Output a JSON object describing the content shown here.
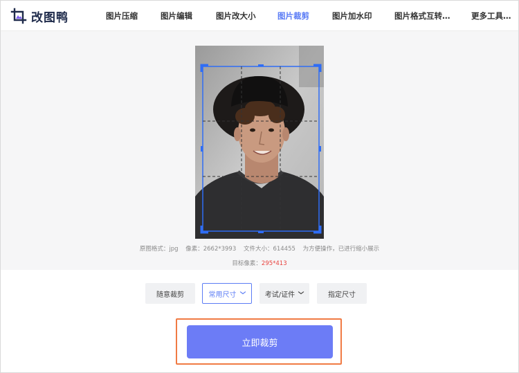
{
  "brand": {
    "name": "改图鸭",
    "icon": "crop-logo-icon"
  },
  "nav": {
    "items": [
      {
        "label": "图片压缩",
        "active": false
      },
      {
        "label": "图片编辑",
        "active": false
      },
      {
        "label": "图片改大小",
        "active": false
      },
      {
        "label": "图片裁剪",
        "active": true
      },
      {
        "label": "图片加水印",
        "active": false
      },
      {
        "label": "图片格式互转…",
        "active": false
      },
      {
        "label": "更多工具…",
        "active": false
      }
    ]
  },
  "info": {
    "format": "原图格式：jpg",
    "pixels": "像素：2662*3993",
    "filesize": "文件大小：614455",
    "note": "为方便操作，已进行缩小展示",
    "target_label": "目标像素：",
    "target_value": "295*413"
  },
  "options": {
    "free": "随意裁剪",
    "common": "常用尺寸",
    "exam": "考试/证件",
    "custom": "指定尺寸",
    "dropdown_icon": "chevron-down-icon"
  },
  "action": {
    "label": "立即裁剪"
  },
  "colors": {
    "accent": "#5b7cf5",
    "button": "#6c7cf6",
    "highlight": "#f07a43",
    "target": "#e8433f"
  }
}
